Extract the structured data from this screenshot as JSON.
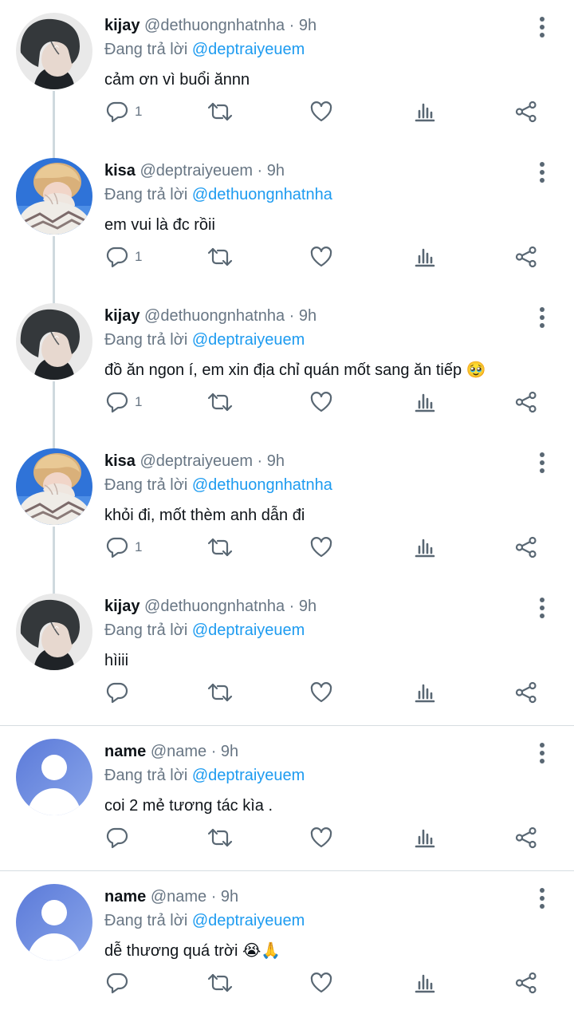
{
  "replying_prefix": "Đang trả lời",
  "tweets": [
    {
      "name": "kijay",
      "handle": "@dethuongnhatnha",
      "time": "· 9h",
      "reply_to": "@deptraiyeuem",
      "text": "cảm ơn vì buổi ănnn",
      "reply_count": "1",
      "avatar": "dark-hair-boy"
    },
    {
      "name": "kisa",
      "handle": "@deptraiyeuem",
      "time": "· 9h",
      "reply_to": "@dethuongnhatnha",
      "text": "em vui là đc rồii",
      "reply_count": "1",
      "avatar": "blonde-hand-cover"
    },
    {
      "name": "kijay",
      "handle": "@dethuongnhatnha",
      "time": "· 9h",
      "reply_to": "@deptraiyeuem",
      "text": "đồ ăn ngon í, em xin địa chỉ quán mốt sang ăn tiếp 🥹",
      "reply_count": "1",
      "avatar": "dark-hair-boy"
    },
    {
      "name": "kisa",
      "handle": "@deptraiyeuem",
      "time": "· 9h",
      "reply_to": "@dethuongnhatnha",
      "text": "khỏi đi, mốt thèm anh dẫn đi",
      "reply_count": "1",
      "avatar": "blonde-hand-cover"
    },
    {
      "name": "kijay",
      "handle": "@dethuongnhatnha",
      "time": "· 9h",
      "reply_to": "@deptraiyeuem",
      "text": "hìiii",
      "reply_count": "",
      "avatar": "dark-hair-boy"
    },
    {
      "name": "name",
      "handle": "@name",
      "time": "· 9h",
      "reply_to": "@deptraiyeuem",
      "text": "coi 2 mẻ tương tác kìa .",
      "reply_count": "",
      "avatar": "default-user"
    },
    {
      "name": "name",
      "handle": "@name",
      "time": "· 9h",
      "reply_to": "@deptraiyeuem",
      "text": "dễ thương quá trời 😭🙏",
      "reply_count": "",
      "avatar": "default-user"
    }
  ],
  "icons": {
    "reply": "reply-icon",
    "retweet": "retweet-icon",
    "like": "like-icon",
    "stats": "stats-icon",
    "share": "share-icon",
    "more": "more-icon"
  },
  "colors": {
    "mention": "#1d9bf0",
    "secondary": "#687684",
    "thread_line": "#cfd9de"
  }
}
